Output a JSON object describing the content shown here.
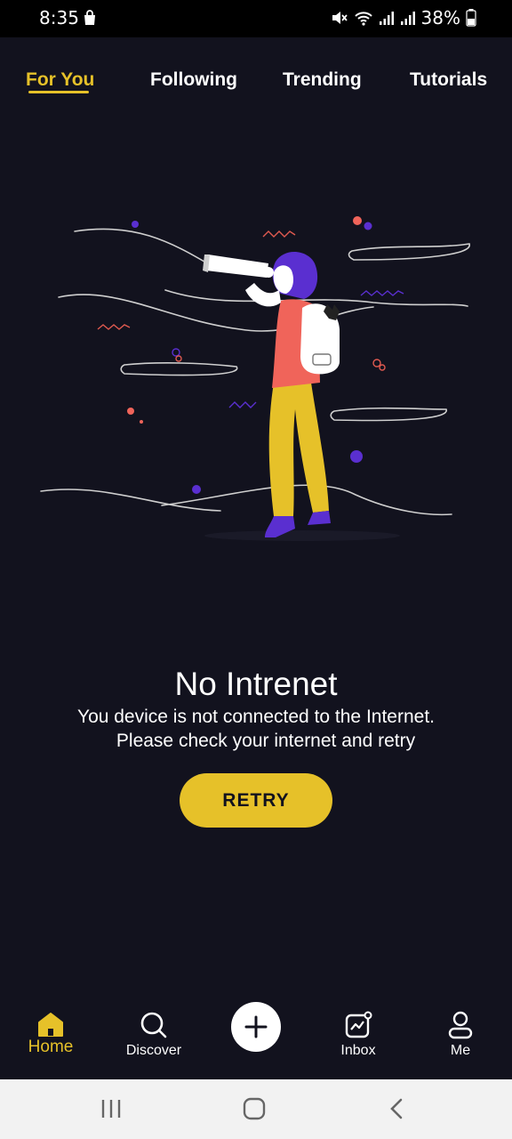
{
  "status_bar": {
    "time": "8:35",
    "battery": "38%",
    "icons": [
      "bag-icon",
      "mute-icon",
      "wifi-icon",
      "signal-icon",
      "signal-icon",
      "battery-icon"
    ]
  },
  "tabs": [
    {
      "label": "For You",
      "active": true
    },
    {
      "label": "Following",
      "active": false
    },
    {
      "label": "Trending",
      "active": false
    },
    {
      "label": "Tutorials",
      "active": false
    }
  ],
  "message": {
    "title": "No Intrenet",
    "line1": "You device is not connected to the Internet.",
    "line2": "Please check your internet and retry"
  },
  "retry_label": "RETRY",
  "bottom_nav": {
    "home": "Home",
    "discover": "Discover",
    "inbox": "Inbox",
    "me": "Me"
  },
  "colors": {
    "accent": "#e6c129",
    "background": "#12121e",
    "purple": "#5a2fd0",
    "coral": "#f0645a"
  }
}
